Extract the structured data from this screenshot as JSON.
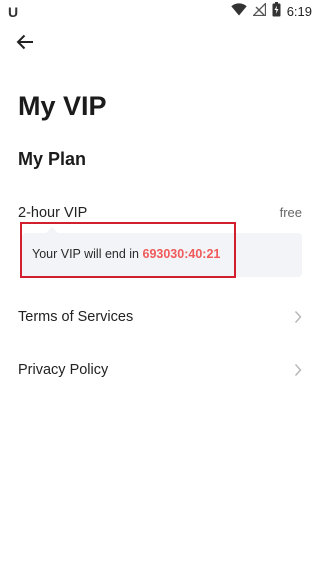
{
  "status_bar": {
    "left_icon": "U",
    "time": "6:19",
    "icons": [
      "wifi-icon",
      "signal-icon",
      "battery-icon"
    ]
  },
  "header": {
    "back_icon": "arrow-left-icon"
  },
  "page": {
    "title": "My VIP",
    "section_title": "My Plan"
  },
  "plan": {
    "name": "2-hour VIP",
    "price": "free",
    "vip_text_prefix": "Your VIP will end in ",
    "countdown": "693030:40:21",
    "countdown_color": "#f05a5a",
    "highlight_color": "#d21f2d"
  },
  "links": [
    {
      "label": "Terms of Services"
    },
    {
      "label": "Privacy Policy"
    }
  ]
}
